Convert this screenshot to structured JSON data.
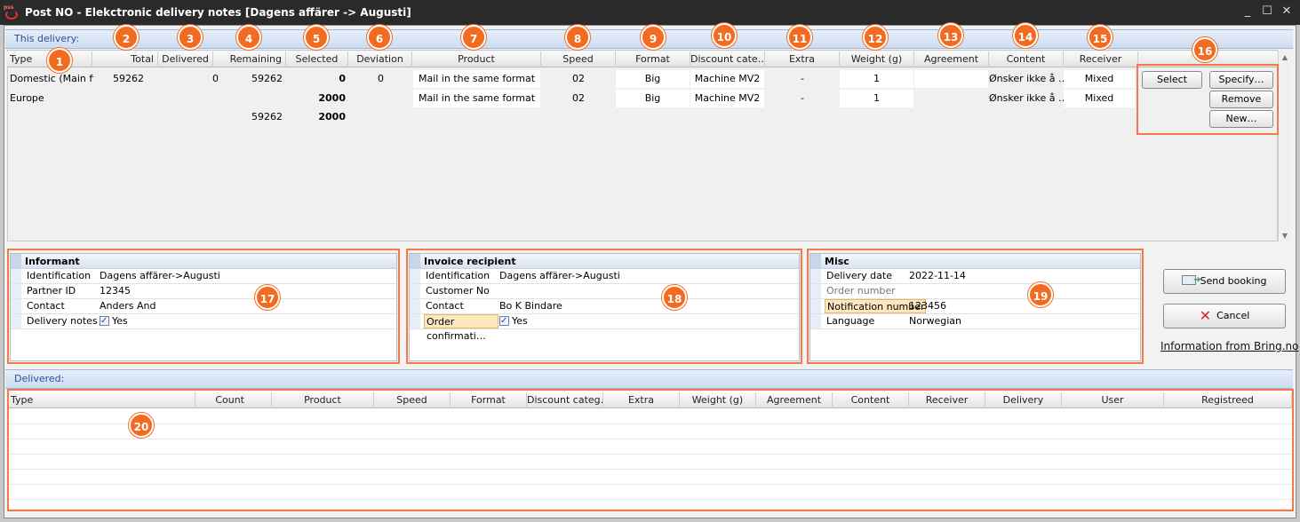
{
  "window": {
    "icon_text": "pss",
    "title": "Post NO - Elekctronic delivery notes [Dagens affärer -> Augusti]",
    "minimize": "_",
    "maximize": "☐",
    "close": "✕"
  },
  "this_delivery": {
    "header": "This delivery:",
    "columns": [
      "Type",
      "Total",
      "Delivered",
      "Remaining",
      "Selected",
      "Deviation",
      "Product",
      "Speed",
      "Format",
      "Discount cate…",
      "Extra",
      "Weight (g)",
      "Agreement",
      "Content",
      "Receiver"
    ],
    "rows": [
      {
        "type": "Domestic (Main fi…",
        "total": "59262",
        "delivered": "0",
        "remaining": "59262",
        "selected": "0",
        "deviation": "0",
        "product": "Mail in the same format",
        "speed": "02",
        "format": "Big",
        "discount": "Machine MV2",
        "extra": "-",
        "weight": "1",
        "agreement": "",
        "content": "Ønsker ikke å …",
        "receiver": "Mixed"
      },
      {
        "type": "Europe",
        "total": "",
        "delivered": "",
        "remaining": "",
        "selected": "2000",
        "deviation": "",
        "product": "Mail in the same format",
        "speed": "02",
        "format": "Big",
        "discount": "Machine MV2",
        "extra": "-",
        "weight": "1",
        "agreement": "",
        "content": "Ønsker ikke å …",
        "receiver": "Mixed"
      }
    ],
    "totals": {
      "remaining": "59262",
      "selected": "2000"
    },
    "buttons": {
      "select": "Select",
      "specify": "Specify…",
      "remove": "Remove",
      "new": "New…"
    }
  },
  "informant": {
    "title": "Informant",
    "rows": [
      {
        "key": "Identification",
        "value": "Dagens affärer->Augusti"
      },
      {
        "key": "Partner ID",
        "value": "12345"
      },
      {
        "key": "Contact",
        "value": "Anders And"
      },
      {
        "key": "Delivery notes",
        "value": "Yes"
      }
    ]
  },
  "invoice": {
    "title": "Invoice recipient",
    "rows": [
      {
        "key": "Identification",
        "value": "Dagens affärer->Augusti"
      },
      {
        "key": "Customer No",
        "value": ""
      },
      {
        "key": "Contact",
        "value": "Bo K Bindare"
      },
      {
        "key": "Order confirmati…",
        "value": "Yes"
      }
    ]
  },
  "misc": {
    "title": "Misc",
    "rows": [
      {
        "key": "Delivery date",
        "value": "2022-11-14"
      },
      {
        "key": "Order number",
        "value": ""
      },
      {
        "key": "Notification number",
        "value": "123456"
      },
      {
        "key": "Language",
        "value": "Norwegian"
      }
    ]
  },
  "actions": {
    "send": "Send booking",
    "cancel": "Cancel",
    "info_link": "Information from Bring.no"
  },
  "delivered": {
    "header": "Delivered:",
    "columns": [
      "Type",
      "Count",
      "Product",
      "Speed",
      "Format",
      "Discount categ…",
      "Extra",
      "Weight (g)",
      "Agreement",
      "Content",
      "Receiver",
      "Delivery",
      "User",
      "Registreed"
    ]
  },
  "badges": [
    "1",
    "2",
    "3",
    "4",
    "5",
    "6",
    "7",
    "8",
    "9",
    "10",
    "11",
    "12",
    "13",
    "14",
    "15",
    "16",
    "17",
    "18",
    "19",
    "20"
  ],
  "colors": {
    "accent": "#f26b20",
    "header_blue": "#2a4f9a",
    "highlight": "#ef7a4c"
  }
}
